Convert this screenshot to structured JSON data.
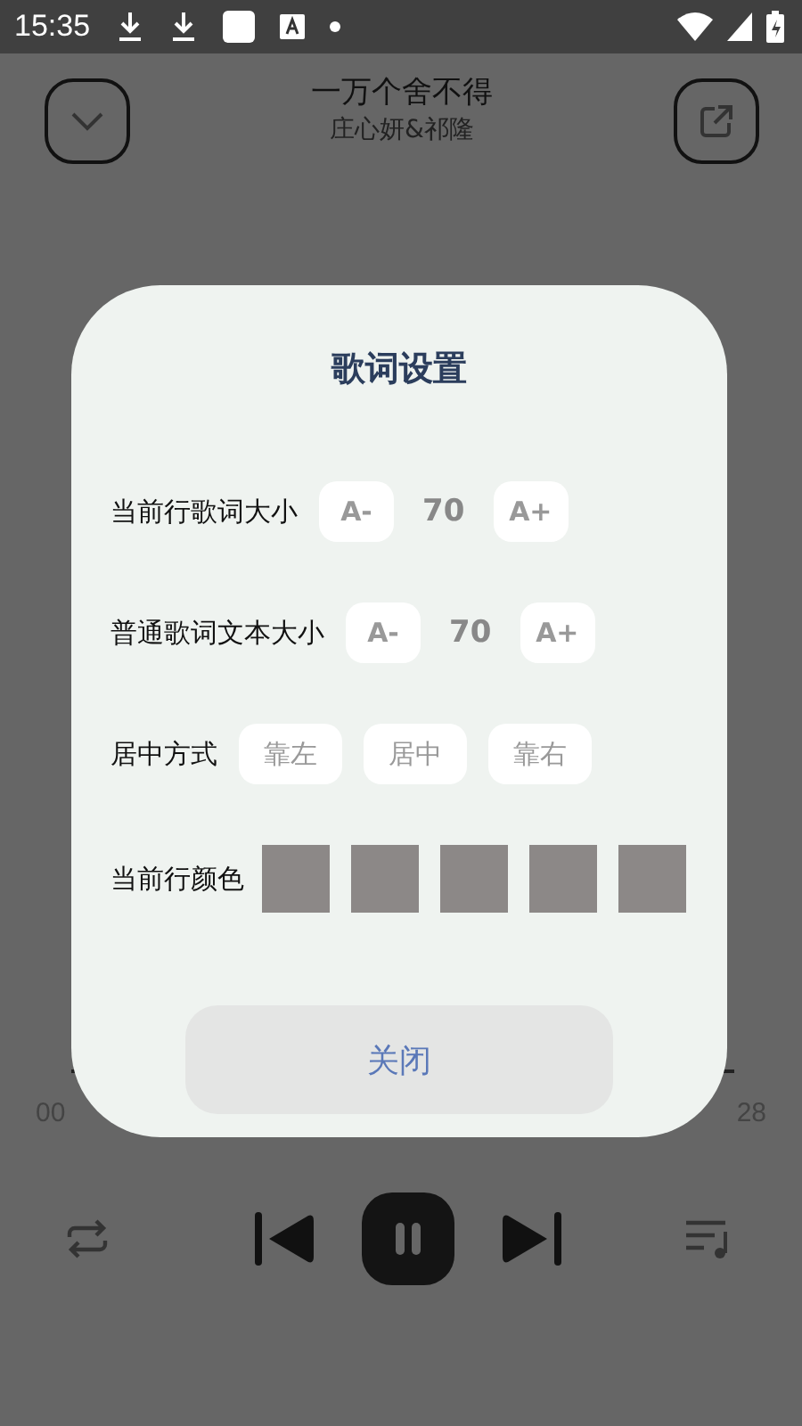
{
  "status_bar": {
    "time": "15:35"
  },
  "header": {
    "title": "一万个舍不得",
    "artist": "庄心妍&祁隆"
  },
  "progress": {
    "elapsed": "00",
    "total": "28"
  },
  "dialog": {
    "title": "歌词设置",
    "settings": [
      {
        "kind": "stepper",
        "label": "当前行歌词大小",
        "decrease": "A-",
        "value": "70",
        "increase": "A+"
      },
      {
        "kind": "stepper",
        "label": "普通歌词文本大小",
        "decrease": "A-",
        "value": "70",
        "increase": "A+"
      },
      {
        "kind": "options",
        "label": "居中方式",
        "options": [
          {
            "label": "靠左"
          },
          {
            "label": "居中"
          },
          {
            "label": "靠右"
          }
        ]
      },
      {
        "kind": "colors",
        "label": "当前行颜色",
        "swatches": [
          {
            "color": "#8c8887"
          },
          {
            "color": "#8c8887"
          },
          {
            "color": "#8c8887"
          },
          {
            "color": "#8c8887"
          },
          {
            "color": "#8c8887"
          }
        ]
      }
    ],
    "close_button": "关闭"
  }
}
